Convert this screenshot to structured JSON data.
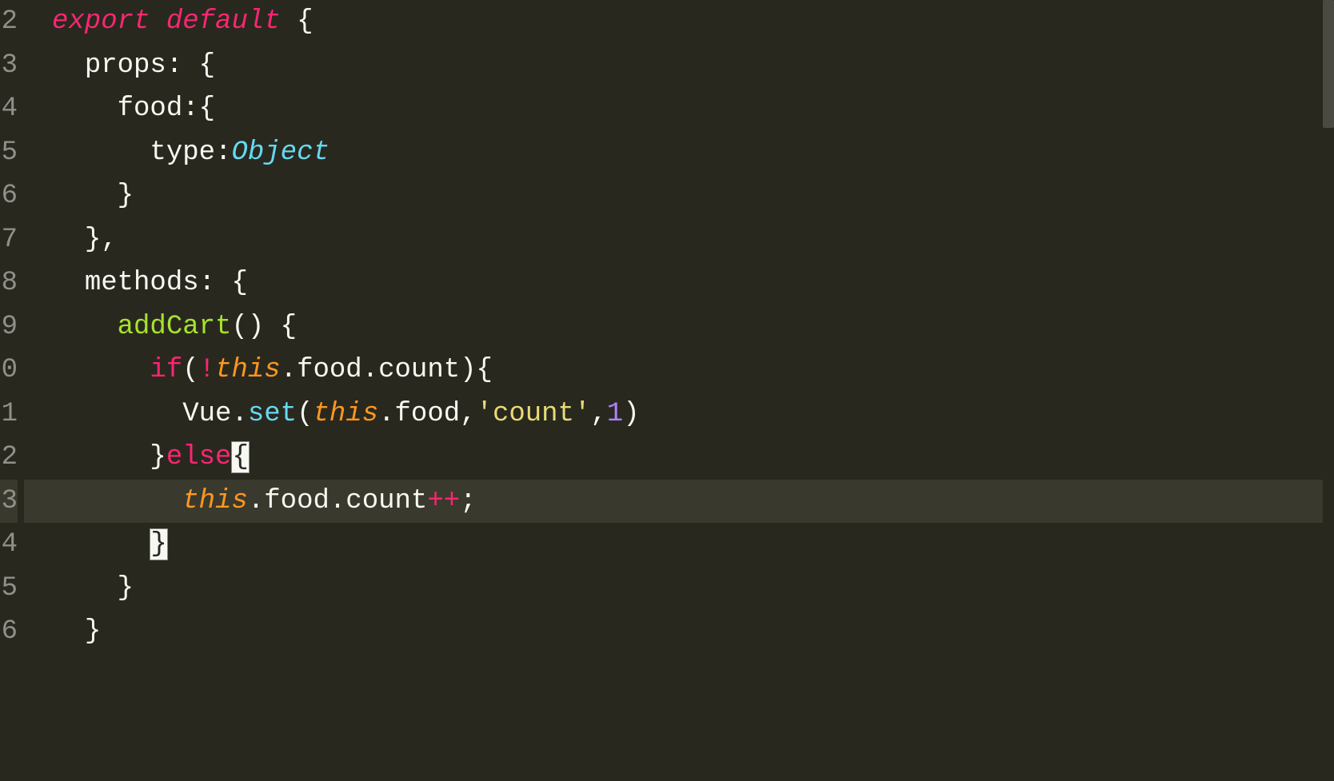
{
  "gutter": {
    "numbers": [
      "2",
      "3",
      "4",
      "5",
      "6",
      "7",
      "8",
      "9",
      "0",
      "1",
      "2",
      "3",
      "4",
      "5",
      "6",
      "",
      ""
    ],
    "activeIndex": 11
  },
  "code": {
    "l0": {
      "indent0": "",
      "export": "export",
      "sp1": " ",
      "default": "default",
      "sp2": " ",
      "brace": "{"
    },
    "l1": {
      "indent": "  ",
      "props": "props",
      "colon": ": {",
      "rest": ""
    },
    "l2": {
      "indent": "    ",
      "food": "food",
      "colon": ":{"
    },
    "l3": {
      "indent": "      ",
      "type": "type",
      "colon": ":",
      "object": "Object"
    },
    "l4": {
      "indent": "    ",
      "brace": "}"
    },
    "l5": {
      "indent": "  ",
      "brace": "},"
    },
    "l6": {
      "indent": "  ",
      "methods": "methods",
      "colon": ": {"
    },
    "l7": {
      "indent": "    ",
      "addCart": "addCart",
      "parens": "() {"
    },
    "l8": {
      "indent": "      ",
      "if": "if",
      "paren1": "(",
      "not": "!",
      "this": "this",
      "dot1": ".",
      "food": "food",
      "dot2": ".",
      "count": "count",
      "paren2": "){"
    },
    "l9": {
      "indent": "        ",
      "vue": "Vue",
      "dot1": ".",
      "set": "set",
      "paren1": "(",
      "this": "this",
      "dot2": ".",
      "food": "food",
      "comma1": ",",
      "str": "'count'",
      "comma2": ",",
      "num": "1",
      "paren2": ")"
    },
    "l10": {
      "indent": "      ",
      "brace1": "}",
      "else": "else",
      "brace2": "{"
    },
    "l11": {
      "indent": "        ",
      "this": "this",
      "dot1": ".",
      "food": "food",
      "dot2": ".",
      "count": "count",
      "op": "++",
      "semi": ";"
    },
    "l12": {
      "indent": "      ",
      "brace": "}"
    },
    "l13": {
      "indent": "    ",
      "brace": "}"
    },
    "l14": {
      "indent": "  ",
      "brace": "}"
    }
  }
}
